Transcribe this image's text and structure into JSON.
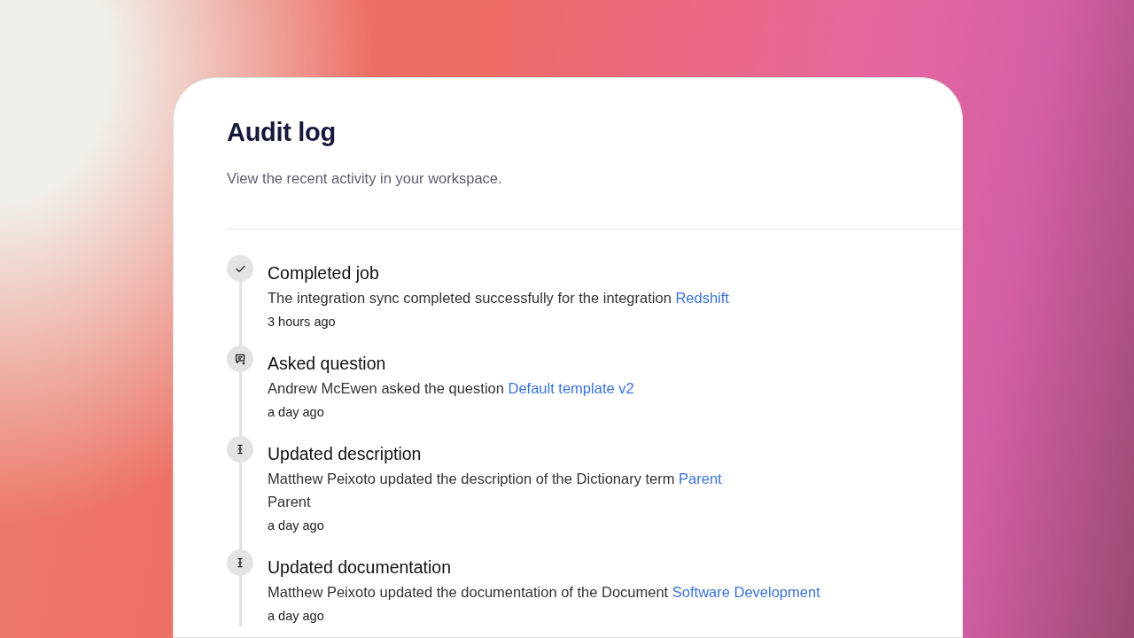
{
  "header": {
    "title": "Audit log",
    "subtitle": "View the recent activity in your workspace."
  },
  "events": [
    {
      "kind": "check",
      "title": "Completed job",
      "text": "The integration sync completed successfully for the integration ",
      "link": "Redshift",
      "time": "3 hours ago"
    },
    {
      "kind": "comment",
      "title": "Asked question",
      "text": "Andrew McEwen asked the question ",
      "link": "Default template v2",
      "time": "a day ago"
    },
    {
      "kind": "text",
      "title": "Updated description",
      "text": "Matthew Peixoto updated the description of the Dictionary term ",
      "link": "Parent",
      "extra": "Parent",
      "time": "a day ago"
    },
    {
      "kind": "text",
      "title": "Updated documentation",
      "text": "Matthew Peixoto updated the documentation of the Document ",
      "link": "Software Development",
      "time": "a day ago"
    }
  ]
}
